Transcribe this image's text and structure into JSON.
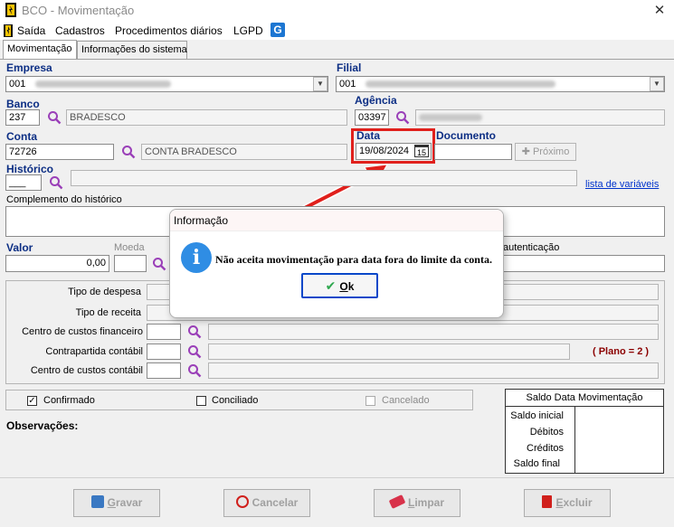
{
  "window": {
    "title": "BCO - Movimentação",
    "close": "✕"
  },
  "menu": {
    "items": [
      "Saída",
      "Cadastros",
      "Procedimentos diários",
      "LGPD"
    ]
  },
  "tabs": [
    {
      "label": "Movimentação"
    },
    {
      "label": "Informações do sistema"
    }
  ],
  "empresa": {
    "label": "Empresa",
    "code": "001"
  },
  "filial": {
    "label": "Filial",
    "code": "001"
  },
  "banco": {
    "label": "Banco",
    "code": "237",
    "name": "BRADESCO"
  },
  "agencia": {
    "label": "Agência",
    "code": "03397"
  },
  "conta": {
    "label": "Conta",
    "code": "72726",
    "name": "CONTA BRADESCO"
  },
  "data": {
    "label": "Data",
    "value": "19/08/2024",
    "cal_icon": "15"
  },
  "documento": {
    "label": "Documento",
    "proximo_label": "Próximo"
  },
  "historico": {
    "label": "Histórico",
    "value": "___",
    "link": "lista de variáveis"
  },
  "complemento": {
    "label": "Complemento do histórico"
  },
  "valor": {
    "label": "Valor",
    "value": "0,00"
  },
  "moeda": {
    "label": "Moeda"
  },
  "autenticacao": {
    "label": "ero autenticação"
  },
  "classificacao": {
    "tipo_despesa": "Tipo de despesa",
    "tipo_receita": "Tipo de receita",
    "centro_custos_financeiro": "Centro de custos financeiro",
    "contrapartida_contabil": "Contrapartida contábil",
    "centro_custos_contabil": "Centro de custos contábil",
    "plano": "( Plano = 2 )"
  },
  "status": {
    "confirmado": {
      "label": "Confirmado",
      "mark": "✓"
    },
    "conciliado": {
      "label": "Conciliado"
    },
    "cancelado": {
      "label": "Cancelado"
    }
  },
  "observacoes": {
    "label": "Observações:"
  },
  "saldo": {
    "title": "Saldo Data Movimentação",
    "rows": [
      "Saldo inicial",
      "Débitos",
      "Créditos",
      "Saldo final"
    ]
  },
  "buttons": {
    "gravar": {
      "key": "G",
      "rest": "ravar"
    },
    "cancelar": {
      "key": "",
      "rest": "Cancelar"
    },
    "limpar": {
      "key": "L",
      "rest": "impar"
    },
    "excluir": {
      "key": "E",
      "rest": "xcluir"
    }
  },
  "dialog": {
    "title": "Informação",
    "message": "Não aceita movimentação para data fora do limite da conta.",
    "ok_key": "O",
    "ok_rest": "k"
  },
  "colors": {
    "label_blue": "#0c2e84",
    "highlight_red": "#e0201c",
    "dialog_accent": "#0a48c9",
    "info_blue": "#2f8de4"
  }
}
